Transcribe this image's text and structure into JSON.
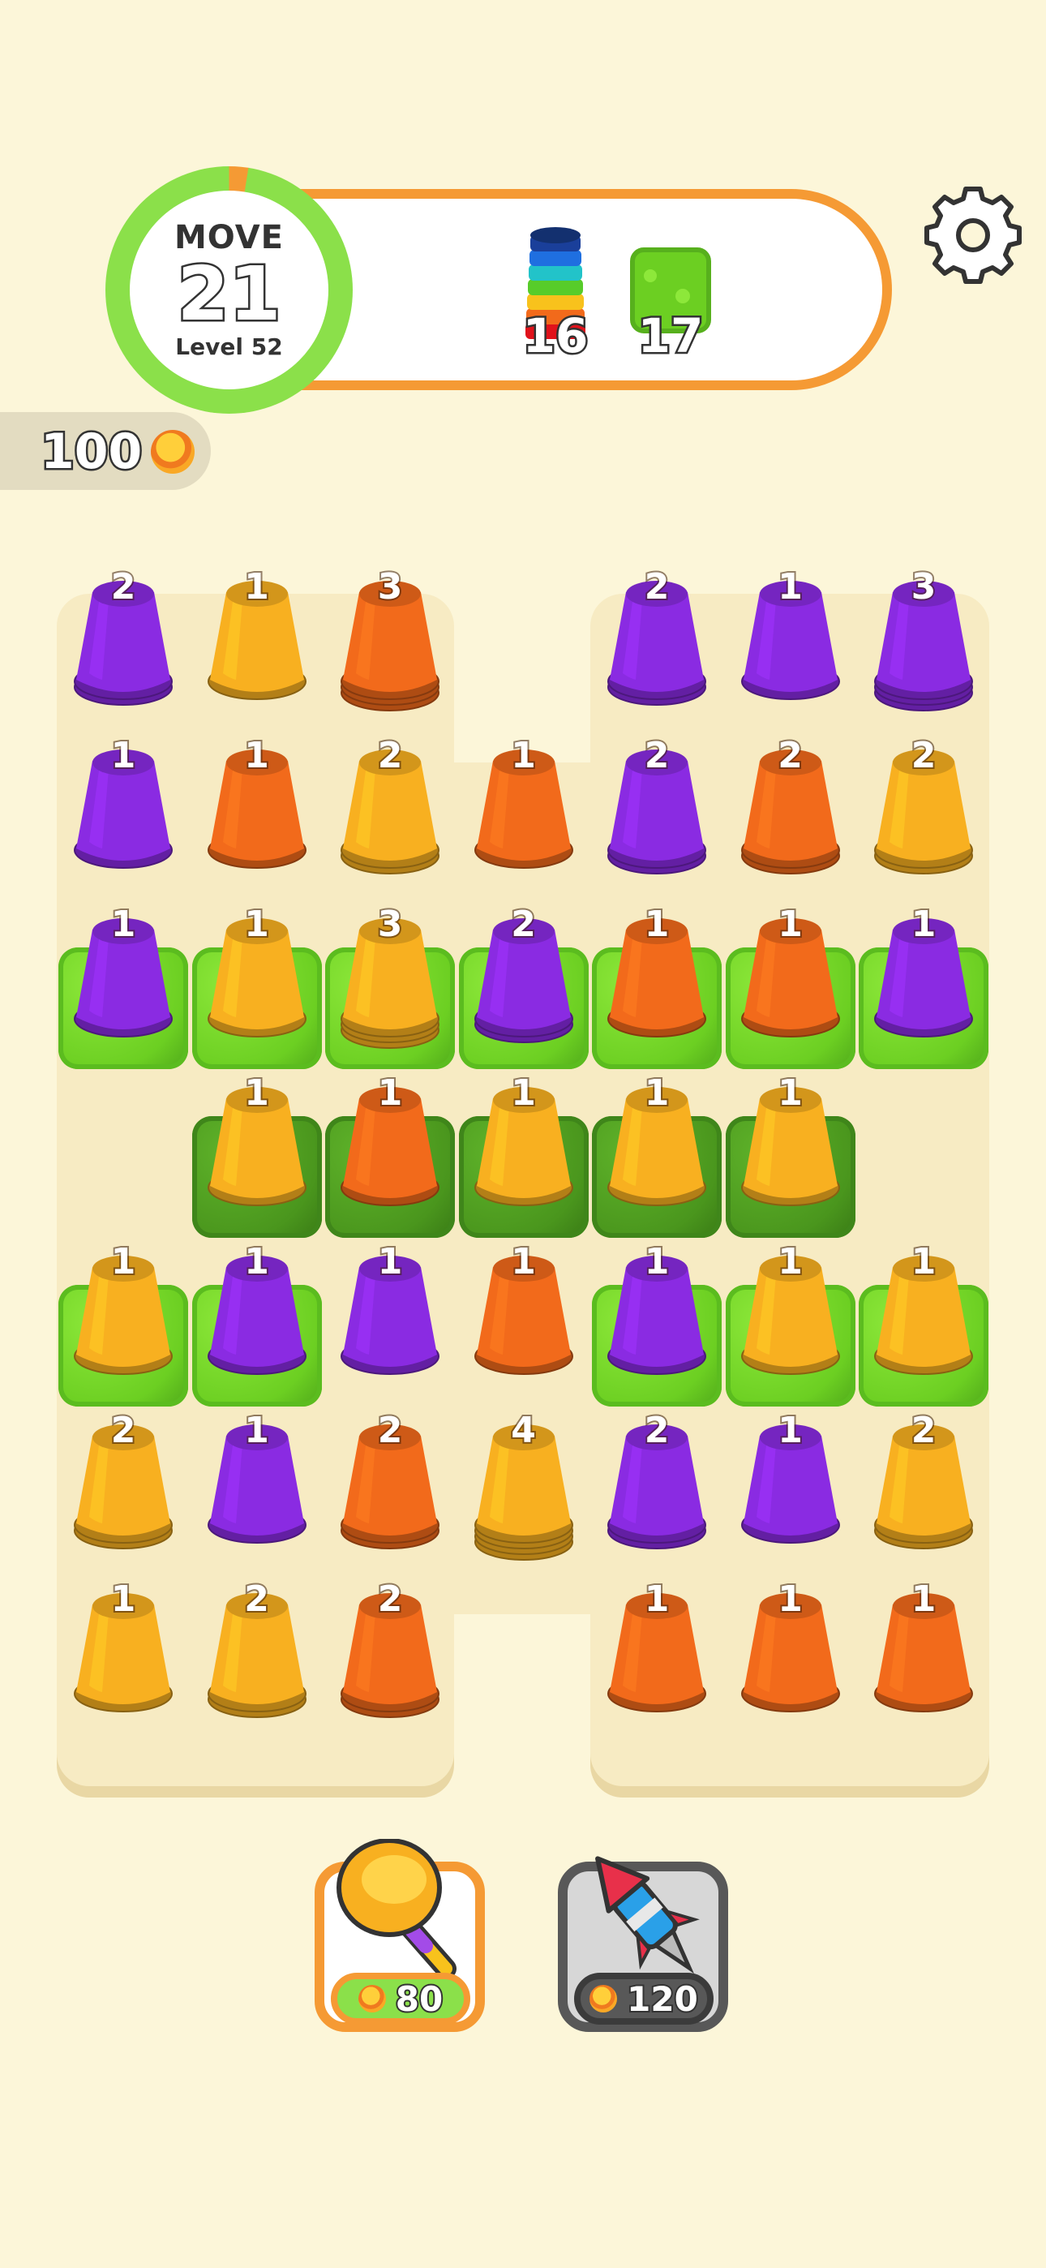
{
  "hud": {
    "move_label": "MOVE",
    "moves_left": "21",
    "level_label": "Level 52",
    "goals": [
      {
        "icon": "rainbow-stack-icon",
        "count": "16"
      },
      {
        "icon": "grass-tile-icon",
        "count": "17"
      }
    ],
    "coins": "100",
    "settings_icon": "gear-icon"
  },
  "colors": {
    "purple": "#8a2be2",
    "orange": "#f26a1b",
    "yellow": "#f8b020",
    "grass_light": "#6ccf22",
    "grass_dark": "#4a961d",
    "accent": "#f59a34",
    "progress": "#8be04a"
  },
  "board": {
    "rows": [
      [
        {
          "color": "purple",
          "count": "2"
        },
        {
          "color": "yellow",
          "count": "1"
        },
        {
          "color": "orange",
          "count": "3"
        },
        null,
        {
          "color": "purple",
          "count": "2"
        },
        {
          "color": "purple",
          "count": "1"
        },
        {
          "color": "purple",
          "count": "3"
        }
      ],
      [
        {
          "color": "purple",
          "count": "1"
        },
        {
          "color": "orange",
          "count": "1"
        },
        {
          "color": "yellow",
          "count": "2"
        },
        {
          "color": "orange",
          "count": "1"
        },
        {
          "color": "purple",
          "count": "2"
        },
        {
          "color": "orange",
          "count": "2"
        },
        {
          "color": "yellow",
          "count": "2"
        }
      ],
      [
        {
          "color": "purple",
          "count": "1",
          "grass": "light"
        },
        {
          "color": "yellow",
          "count": "1",
          "grass": "light"
        },
        {
          "color": "yellow",
          "count": "3",
          "grass": "light"
        },
        {
          "color": "purple",
          "count": "2",
          "grass": "light"
        },
        {
          "color": "orange",
          "count": "1",
          "grass": "light"
        },
        {
          "color": "orange",
          "count": "1",
          "grass": "light"
        },
        {
          "color": "purple",
          "count": "1",
          "grass": "light"
        }
      ],
      [
        null,
        {
          "color": "yellow",
          "count": "1",
          "grass": "dark"
        },
        {
          "color": "orange",
          "count": "1",
          "grass": "dark"
        },
        {
          "color": "yellow",
          "count": "1",
          "grass": "dark"
        },
        {
          "color": "yellow",
          "count": "1",
          "grass": "dark"
        },
        {
          "color": "yellow",
          "count": "1",
          "grass": "dark"
        },
        null
      ],
      [
        {
          "color": "yellow",
          "count": "1",
          "grass": "light"
        },
        {
          "color": "purple",
          "count": "1",
          "grass": "light"
        },
        {
          "color": "purple",
          "count": "1"
        },
        {
          "color": "orange",
          "count": "1"
        },
        {
          "color": "purple",
          "count": "1",
          "grass": "light"
        },
        {
          "color": "yellow",
          "count": "1",
          "grass": "light"
        },
        {
          "color": "yellow",
          "count": "1",
          "grass": "light"
        }
      ],
      [
        {
          "color": "yellow",
          "count": "2"
        },
        {
          "color": "purple",
          "count": "1"
        },
        {
          "color": "orange",
          "count": "2"
        },
        {
          "color": "yellow",
          "count": "4"
        },
        {
          "color": "purple",
          "count": "2"
        },
        {
          "color": "purple",
          "count": "1"
        },
        {
          "color": "yellow",
          "count": "2"
        }
      ],
      [
        {
          "color": "yellow",
          "count": "1"
        },
        {
          "color": "yellow",
          "count": "2"
        },
        {
          "color": "orange",
          "count": "2"
        },
        null,
        {
          "color": "orange",
          "count": "1"
        },
        {
          "color": "orange",
          "count": "1"
        },
        {
          "color": "orange",
          "count": "1"
        }
      ]
    ]
  },
  "boosters": [
    {
      "name": "hammer",
      "icon": "hammer-icon",
      "price": "80"
    },
    {
      "name": "rocket",
      "icon": "rocket-icon",
      "price": "120"
    }
  ]
}
